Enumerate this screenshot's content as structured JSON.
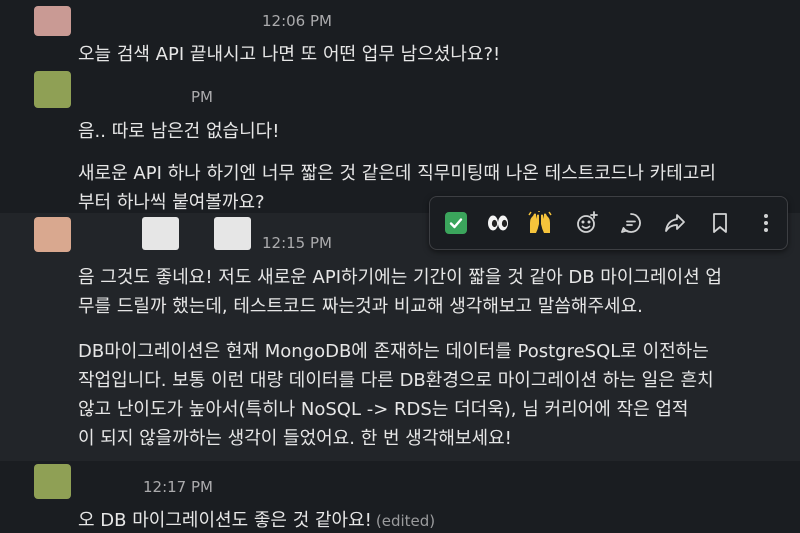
{
  "messages": [
    {
      "time": "12:06 PM",
      "lines": [
        "오늘 검색 API 끝내시고 나면 또 어떤 업무 남으셨나요?!"
      ],
      "avatar_color": "#c99a94"
    },
    {
      "time": "PM",
      "lines": [
        "음.. 따로 남은건 없습니다!",
        "새로운 API 하나 하기엔 너무 짧은 것 같은데 직무미팅때 나온 테스트코드나 카테고리",
        "부터 하나씩 붙여볼까요?"
      ],
      "avatar_color": "#8fa055"
    },
    {
      "time": "12:15 PM",
      "lines": [
        "음 그것도 좋네요! 저도 새로운 API하기에는 기간이 짧을 것 같아 DB 마이그레이션 업",
        "무를 드릴까 했는데, 테스트코드 짜는것과 비교해 생각해보고 말씀해주세요.",
        "DB마이그레이션은 현재 MongoDB에 존재하는 데이터를 PostgreSQL로 이전하는",
        "작업입니다. 보통 이런 대량 데이터를 다른 DB환경으로 마이그레이션 하는 일은 흔치",
        "않고 난이도가 높아서(특히나 NoSQL -> RDS는 더더욱),         님 커리어에 작은 업적",
        "이 되지 않을까하는 생각이 들었어요. 한 번 생각해보세요!"
      ],
      "avatar_color": "#d9a88f"
    },
    {
      "time": "12:17 PM",
      "lines": [
        "오 DB 마이그레이션도 좋은 것 같아요!"
      ],
      "edited": "(edited)",
      "avatar_color": "#8fa055"
    }
  ],
  "toolbar": {
    "reactions": [
      {
        "icon": "white-check-mark",
        "glyph": "✓",
        "color": "#3ba55c"
      },
      {
        "icon": "eyes",
        "glyph": "👀"
      },
      {
        "icon": "raised-hands",
        "glyph": "🙌"
      }
    ],
    "actions": [
      "add-reaction-icon",
      "reply-in-thread-icon",
      "share-icon",
      "bookmark-icon",
      "more-actions-icon"
    ]
  }
}
